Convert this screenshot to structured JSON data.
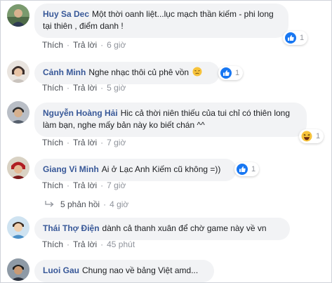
{
  "comments": [
    {
      "author": "Huy Sa Dec",
      "text": "Một thời oanh liệt...lục mạch thần kiếm - phi long tại thiên , điểm danh !",
      "like_label": "Thích",
      "reply_label": "Trả lời",
      "time": "6 giờ",
      "reaction": "like-icon",
      "reaction_count": "1"
    },
    {
      "author": "Cảnh Minh",
      "text": "Nghe nhạc thôi củ phê vồn",
      "emoji": "disappointed-emoji-icon",
      "like_label": "Thích",
      "reply_label": "Trả lời",
      "time": "5 giờ",
      "reaction": "like-icon",
      "reaction_count": "1"
    },
    {
      "author": "Nguyễn Hoàng Hải",
      "text": "Hic cả thời niên thiếu của tui chỉ có thiên long làm bạn, nghe mấy bản này ko biết chán ^^",
      "like_label": "Thích",
      "reply_label": "Trả lời",
      "time": "7 giờ",
      "reaction": "haha-icon",
      "reaction_count": "1"
    },
    {
      "author": "Giang Vi Minh",
      "text": "Ai ở Lạc Anh Kiếm cũ không =))",
      "like_label": "Thích",
      "reply_label": "Trả lời",
      "time": "7 giờ",
      "reaction": "like-icon",
      "reaction_count": "1",
      "replies_label": "5 phản hồi",
      "replies_time": "4 giờ"
    },
    {
      "author": "Thái Thợ Điện",
      "text": "dành cả thanh xuân để chờ game này về vn",
      "like_label": "Thích",
      "reply_label": "Trả lời",
      "time": "45 phút"
    },
    {
      "author": "Luoi Gau",
      "text": "Chung nao về bảng Việt amd..."
    }
  ],
  "colors": {
    "author": "#385898",
    "bubble": "#f2f3f5",
    "meta": "#90949c",
    "like_blue": "#1877f2",
    "haha_yellow": "#f7c33b"
  }
}
